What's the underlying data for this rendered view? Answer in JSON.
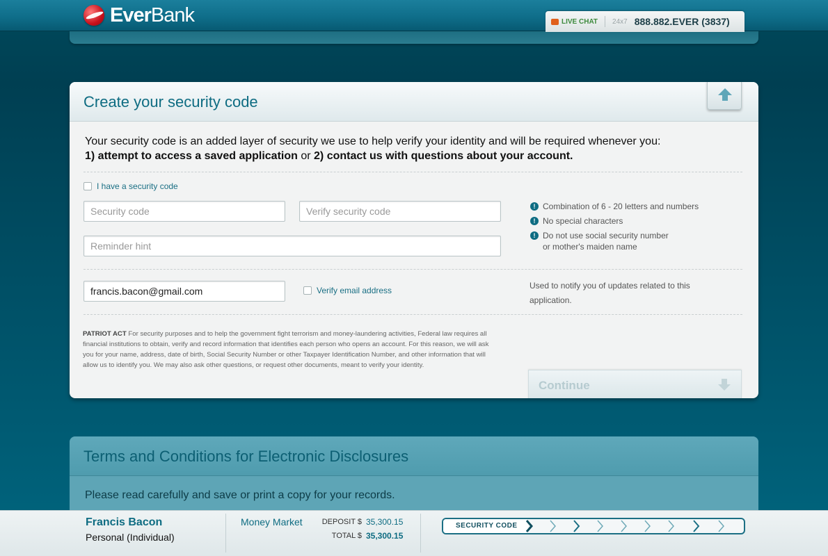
{
  "header": {
    "brand_left": "Ever",
    "brand_right": "Bank",
    "livechat": "LIVE CHAT",
    "hours": "24x7",
    "phone": "888.882.EVER (3837)"
  },
  "panel": {
    "title": "Create your security code",
    "intro_line1": "Your security code is an added layer of security we use to help verify your identity and will be required whenever you:",
    "intro_part1": "1) attempt to access a saved application",
    "intro_or": " or ",
    "intro_part2": "2) contact us with questions about your account.",
    "have_code_label": "I have a security code",
    "security_code_placeholder": "Security code",
    "verify_code_placeholder": "Verify security code",
    "reminder_placeholder": "Reminder hint",
    "tips": [
      "Combination of 6 - 20 letters and numbers",
      "No special characters",
      "Do not use social security number or mother's maiden name"
    ],
    "email_value": "francis.bacon@gmail.com",
    "verify_email_label": "Verify email address",
    "email_note": "Used to notify you of updates related to this application.",
    "patriot_title": "PATRIOT ACT",
    "patriot_text": " For security purposes and to help the government fight terrorism and money-laundering activities, Federal law requires all financial institutions to obtain, verify and record information that identifies each person who opens an account. For this reason, we will ask you for your name, address, date of birth, Social Security Number or other Taxpayer Identification Number, and other information that will allow us to identify you. We may also ask other questions, or request other documents, meant to verify your identity.",
    "continue_label": "Continue"
  },
  "terms": {
    "title": "Terms and Conditions for Electronic Disclosures",
    "text": "Please read carefully and save or print a copy for your records."
  },
  "footer": {
    "name": "Francis Bacon",
    "account_type": "Personal (Individual)",
    "product": "Money Market",
    "deposit_label": "DEPOSIT $",
    "deposit_value": "35,300.15",
    "total_label": "TOTAL $",
    "total_value": "35,300.15",
    "step_current": "SECURITY CODE"
  },
  "colors": {
    "accent": "#0e6c82",
    "brand_red": "#c8101c"
  }
}
